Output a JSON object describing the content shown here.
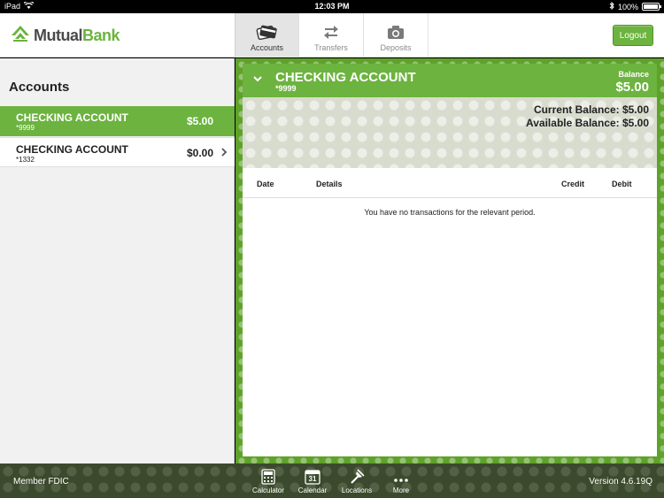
{
  "status_bar": {
    "device": "iPad",
    "time": "12:03 PM",
    "battery": "100%",
    "battery_level": 1.0
  },
  "header": {
    "brand_part1": "Mutual",
    "brand_part2": "Bank",
    "tabs": [
      {
        "label": "Accounts",
        "icon": "cards-icon",
        "active": true
      },
      {
        "label": "Transfers",
        "icon": "transfer-arrows-icon",
        "active": false
      },
      {
        "label": "Deposits",
        "icon": "camera-icon",
        "active": false
      }
    ],
    "logout_label": "Logout"
  },
  "sidebar": {
    "title": "Accounts",
    "accounts": [
      {
        "name": "CHECKING ACCOUNT",
        "number": "*9999",
        "amount": "$5.00",
        "selected": true
      },
      {
        "name": "CHECKING ACCOUNT",
        "number": "*1332",
        "amount": "$0.00",
        "selected": false
      }
    ]
  },
  "account_detail": {
    "title": "CHECKING ACCOUNT",
    "number": "*9999",
    "balance_label": "Balance",
    "balance": "$5.00",
    "current_balance": "Current Balance: $5.00",
    "available_balance": "Available Balance: $5.00"
  },
  "transactions": {
    "columns": [
      "Date",
      "Details",
      "Credit",
      "Debit"
    ],
    "empty_message": "You have no transactions for the relevant period."
  },
  "bottom_bar": {
    "member_fdic": "Member FDIC",
    "version": "Version 4.6.19Q",
    "tools": [
      {
        "label": "Calculator",
        "icon": "calculator-icon"
      },
      {
        "label": "Calendar",
        "icon": "calendar-icon",
        "day": "31"
      },
      {
        "label": "Locations",
        "icon": "map-pin-icon"
      },
      {
        "label": "More",
        "icon": "more-dots-icon"
      }
    ]
  },
  "colors": {
    "accent_green": "#6cb33f",
    "dark_bar": "#3b4a2c"
  }
}
